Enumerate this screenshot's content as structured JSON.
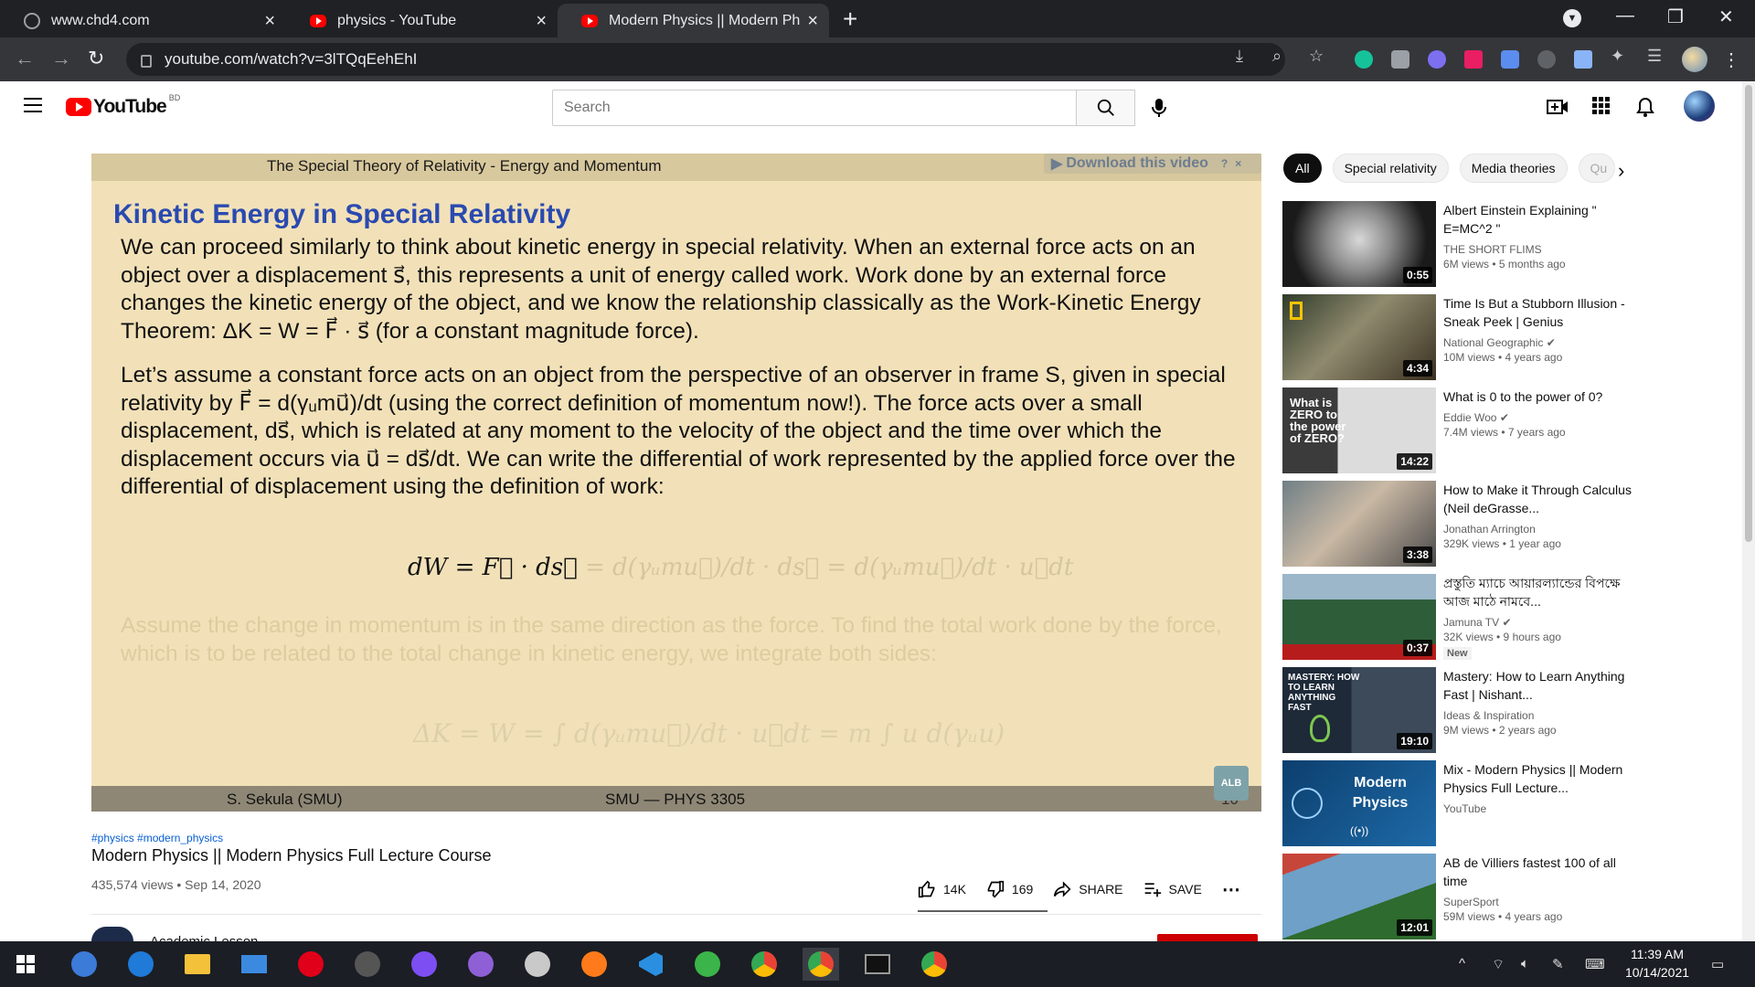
{
  "browser": {
    "tabs": [
      {
        "title": "www.chd4.com",
        "favicon": "globe-icon"
      },
      {
        "title": "physics - YouTube",
        "favicon": "youtube-icon"
      },
      {
        "title": "Modern Physics || Modern Physic",
        "favicon": "youtube-icon"
      }
    ],
    "url": "youtube.com/watch?v=3lTQqEehEhI"
  },
  "youtube": {
    "logo_text": "YouTube",
    "country": "BD",
    "search_placeholder": "Search"
  },
  "slide": {
    "header": "The Special Theory of Relativity - Energy and Momentum",
    "download_label": "Download this video",
    "title": "Kinetic Energy in Special Relativity",
    "para1": "We can proceed similarly to think about kinetic energy in special relativity. When an external force acts on an object over a displacement s⃗, this represents a unit of energy called work. Work done by an external force changes the kinetic energy of the object, and we know the relationship classically as the Work-Kinetic Energy Theorem: ΔK = W = F⃗ · s⃗ (for a constant magnitude force).",
    "para2": "Let’s assume a constant force acts on an object from the perspective of an observer in frame S, given in special relativity by F⃗ = d(γᵤmu⃗)/dt (using the correct definition of momentum now!). The force acts over a small displacement, ds⃗, which is related at any moment to the velocity of the object and the time over which the displacement occurs via u⃗ = ds⃗/dt. We can write the differential of work represented by the applied force over the differential of displacement using the definition of work:",
    "eq_visible": "dW = F⃗ · ds⃗",
    "eq_faded": " = d(γᵤmu⃗)/dt · ds⃗ = d(γᵤmu⃗)/dt · u⃗dt",
    "para3": "Assume the change in momentum is in the same direction as the force. To find the total work done by the force, which is to be related to the total change in kinetic energy, we integrate both sides:",
    "eq2": "ΔK = W = ∫ d(γᵤmu⃗)/dt · u⃗dt = m ∫ u d(γᵤu)",
    "footer_left": "S. Sekula  (SMU)",
    "footer_mid": "SMU — PHYS 3305",
    "page_num": "10",
    "badge": "ALB"
  },
  "video": {
    "hashtags": "#physics #modern_physics",
    "title": "Modern Physics || Modern Physics Full Lecture Course",
    "meta": "435,574 views • Sep 14, 2020",
    "likes": "14K",
    "dislikes": "169",
    "share_label": "SHARE",
    "save_label": "SAVE",
    "channel": "Academic Lesson"
  },
  "chips": [
    "All",
    "Special relativity",
    "Media theories",
    "Qu"
  ],
  "recommendations": [
    {
      "title": "Albert Einstein Explaining \" E=MC^2 \"",
      "channel": "THE SHORT FLIMS",
      "meta": "6M views • 5 months ago",
      "duration": "0:55",
      "verified": false,
      "new": false
    },
    {
      "title": "Time Is But a Stubborn Illusion - Sneak Peek | Genius",
      "channel": "National Geographic",
      "meta": "10M views • 4 years ago",
      "duration": "4:34",
      "verified": true,
      "new": false
    },
    {
      "title": "What is 0 to the power of 0?",
      "channel": "Eddie Woo",
      "meta": "7.4M views • 7 years ago",
      "duration": "14:22",
      "verified": true,
      "new": false,
      "thumb_text": "What is ZERO to the power of ZERO?"
    },
    {
      "title": "How to Make it Through Calculus (Neil deGrasse...",
      "channel": "Jonathan Arrington",
      "meta": "329K views • 1 year ago",
      "duration": "3:38",
      "verified": false,
      "new": false
    },
    {
      "title": "প্রস্তুতি ম্যাচে আয়ারল্যান্ডের বিপক্ষে আজ মাঠে নামবে...",
      "channel": "Jamuna TV",
      "meta": "32K views • 9 hours ago",
      "duration": "0:37",
      "verified": true,
      "new": true,
      "new_label": "New"
    },
    {
      "title": "Mastery: How to Learn Anything Fast | Nishant...",
      "channel": "Ideas & Inspiration",
      "meta": "9M views • 2 years ago",
      "duration": "19:10",
      "verified": false,
      "new": false,
      "thumb_text": "MASTERY: HOW TO LEARN ANYTHING FAST"
    },
    {
      "title": "Mix - Modern Physics || Modern Physics Full Lecture...",
      "channel": "YouTube",
      "meta": "",
      "duration": "",
      "verified": false,
      "new": false,
      "thumb_text": "Modern Physics"
    },
    {
      "title": "AB de Villiers fastest 100 of all time",
      "channel": "SuperSport",
      "meta": "59M views • 4 years ago",
      "duration": "12:01",
      "verified": false,
      "new": false
    }
  ],
  "taskbar": {
    "time": "11:39 AM",
    "date": "10/14/2021"
  },
  "colors": {
    "youtube_red": "#ff0000",
    "slide_bg": "#f2e1b8",
    "slide_title": "#2a4ab0",
    "chrome_dark": "#202124"
  }
}
